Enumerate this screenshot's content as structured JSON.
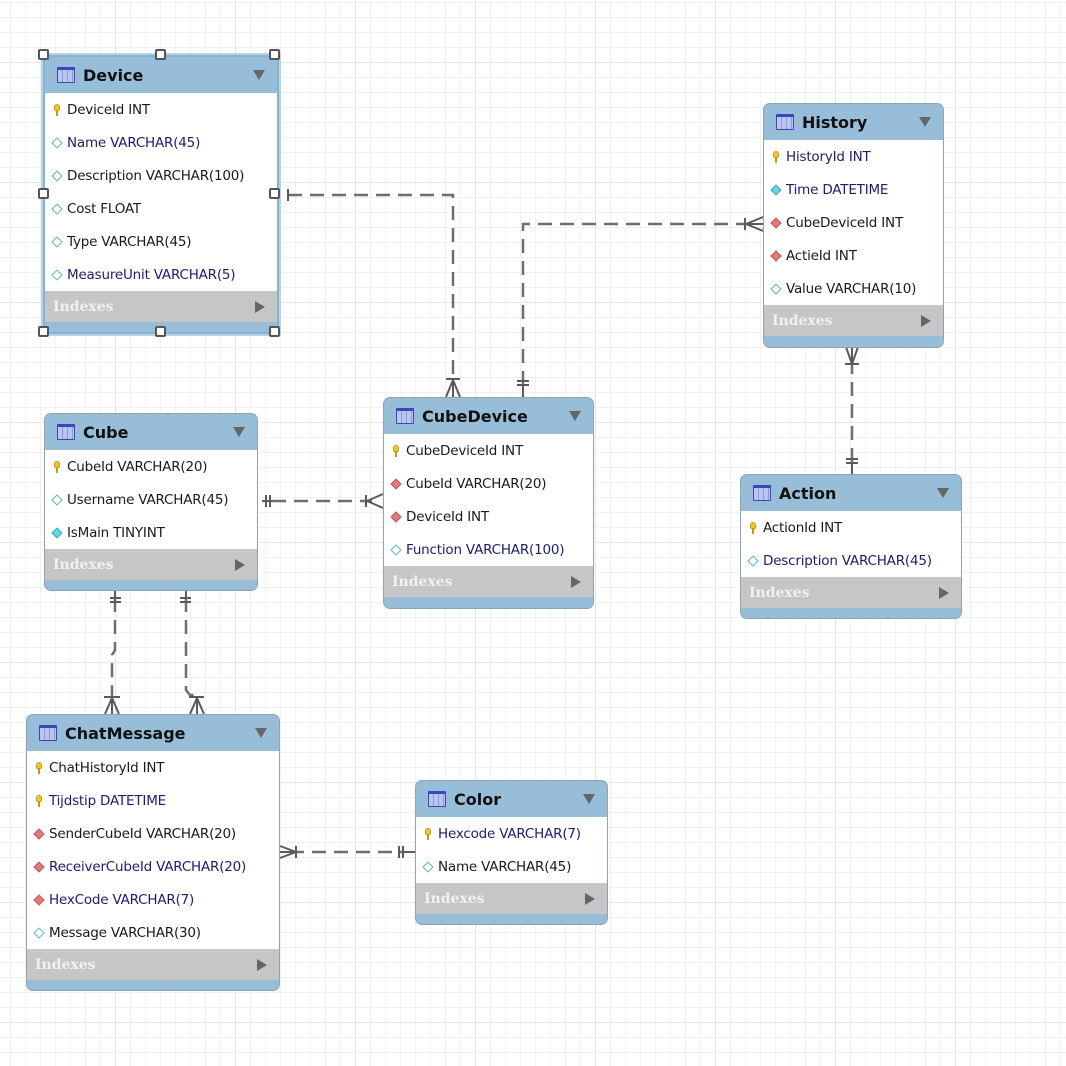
{
  "diagram": {
    "type": "EER diagram",
    "selected_table": "Device",
    "colors": {
      "header": "#97bdd8",
      "indexes_bar": "#c6c6c6",
      "connector": "#6e6e6e",
      "grid_minor": "#f1f1f1",
      "grid_major": "#e6e6e6"
    }
  },
  "tables": {
    "device": {
      "name": "Device",
      "indexes_label": "Indexes",
      "columns": [
        {
          "label": "DeviceId INT",
          "icon": "primary-key"
        },
        {
          "label": "Name VARCHAR(45)",
          "icon": "column-nullable"
        },
        {
          "label": "Description VARCHAR(100)",
          "icon": "column-nullable"
        },
        {
          "label": "Cost FLOAT",
          "icon": "column-nullable"
        },
        {
          "label": "Type VARCHAR(45)",
          "icon": "column-nullable"
        },
        {
          "label": "MeasureUnit VARCHAR(5)",
          "icon": "column-nullable"
        }
      ]
    },
    "history": {
      "name": "History",
      "indexes_label": "Indexes",
      "columns": [
        {
          "label": "HistoryId INT",
          "icon": "primary-key"
        },
        {
          "label": "Time DATETIME",
          "icon": "column-not-null"
        },
        {
          "label": "CubeDeviceId INT",
          "icon": "foreign-key"
        },
        {
          "label": "ActieId INT",
          "icon": "foreign-key"
        },
        {
          "label": "Value VARCHAR(10)",
          "icon": "column-nullable"
        }
      ]
    },
    "cubedevice": {
      "name": "CubeDevice",
      "indexes_label": "Indexes",
      "columns": [
        {
          "label": "CubeDeviceId INT",
          "icon": "primary-key"
        },
        {
          "label": "CubeId VARCHAR(20)",
          "icon": "foreign-key"
        },
        {
          "label": "DeviceId INT",
          "icon": "foreign-key"
        },
        {
          "label": "Function VARCHAR(100)",
          "icon": "column-nullable"
        }
      ]
    },
    "cube": {
      "name": "Cube",
      "indexes_label": "Indexes",
      "columns": [
        {
          "label": "CubeId VARCHAR(20)",
          "icon": "primary-key"
        },
        {
          "label": "Username VARCHAR(45)",
          "icon": "column-nullable"
        },
        {
          "label": "IsMain TINYINT",
          "icon": "column-not-null"
        }
      ]
    },
    "action": {
      "name": "Action",
      "indexes_label": "Indexes",
      "columns": [
        {
          "label": "ActionId INT",
          "icon": "primary-key"
        },
        {
          "label": "Description VARCHAR(45)",
          "icon": "column-nullable"
        }
      ]
    },
    "chatmessage": {
      "name": "ChatMessage",
      "indexes_label": "Indexes",
      "columns": [
        {
          "label": "ChatHistoryId INT",
          "icon": "primary-key"
        },
        {
          "label": "Tijdstip DATETIME",
          "icon": "primary-key"
        },
        {
          "label": "SenderCubeId VARCHAR(20)",
          "icon": "foreign-key"
        },
        {
          "label": "ReceiverCubeId VARCHAR(20)",
          "icon": "foreign-key"
        },
        {
          "label": "HexCode VARCHAR(7)",
          "icon": "foreign-key"
        },
        {
          "label": "Message VARCHAR(30)",
          "icon": "column-nullable"
        }
      ]
    },
    "color": {
      "name": "Color",
      "indexes_label": "Indexes",
      "columns": [
        {
          "label": "Hexcode VARCHAR(7)",
          "icon": "primary-key"
        },
        {
          "label": "Name VARCHAR(45)",
          "icon": "column-nullable"
        }
      ]
    }
  },
  "relationships": [
    {
      "from": "Device",
      "to": "CubeDevice",
      "from_cardinality": "one",
      "to_cardinality": "one-or-many",
      "identifying": false
    },
    {
      "from": "CubeDevice",
      "to": "History",
      "from_cardinality": "one-and-only-one",
      "to_cardinality": "one-or-many",
      "identifying": false
    },
    {
      "from": "Cube",
      "to": "CubeDevice",
      "from_cardinality": "one-and-only-one",
      "to_cardinality": "one-or-many",
      "identifying": false
    },
    {
      "from": "Action",
      "to": "History",
      "from_cardinality": "one-and-only-one",
      "to_cardinality": "one-or-many",
      "identifying": false
    },
    {
      "from": "Cube",
      "to": "ChatMessage",
      "from_cardinality": "one-and-only-one",
      "to_cardinality": "one-or-many",
      "identifying": false
    },
    {
      "from": "Cube",
      "to": "ChatMessage",
      "from_cardinality": "one-and-only-one",
      "to_cardinality": "one-or-many",
      "identifying": false
    },
    {
      "from": "Color",
      "to": "ChatMessage",
      "from_cardinality": "one-and-only-one",
      "to_cardinality": "one-or-many",
      "identifying": false
    }
  ]
}
